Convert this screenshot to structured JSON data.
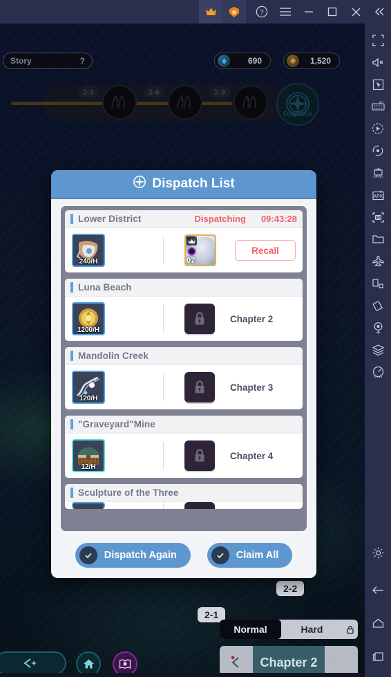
{
  "titlebar": {
    "buttons": [
      {
        "name": "premium-crown-button",
        "icon": "crown-icon",
        "label": "♛"
      },
      {
        "name": "shield-boost-button",
        "icon": "shield-icon",
        "label": "⬢"
      },
      {
        "name": "help-button",
        "icon": "help-circle-icon",
        "label": "?"
      },
      {
        "name": "menu-button",
        "icon": "hamburger-menu-icon",
        "label": "☰"
      },
      {
        "name": "minimize-button",
        "icon": "minimize-icon",
        "label": "—"
      },
      {
        "name": "maximize-button",
        "icon": "maximize-icon",
        "label": "□"
      },
      {
        "name": "close-button",
        "icon": "close-icon",
        "label": "✕"
      },
      {
        "name": "collapse-sidebar-button",
        "icon": "chevron-double-left-icon",
        "label": "«"
      }
    ]
  },
  "sidebar": {
    "items": [
      {
        "name": "fullscreen-icon",
        "label": "Fullscreen"
      },
      {
        "name": "mute-icon",
        "label": "Mute"
      },
      {
        "name": "cursor-icon",
        "label": "Pointer"
      },
      {
        "name": "keyboard-icon",
        "label": "Keyboard mapping"
      },
      {
        "name": "macro-record-icon",
        "label": "Macro"
      },
      {
        "name": "sync-icon",
        "label": "Sync"
      },
      {
        "name": "multi-instance-icon",
        "label": "Multi instance"
      },
      {
        "name": "apk-install-icon",
        "label": "Install APK"
      },
      {
        "name": "screenshot-icon",
        "label": "Screenshot"
      },
      {
        "name": "folder-icon",
        "label": "Media folder"
      },
      {
        "name": "airplane-icon",
        "label": "Eco mode"
      },
      {
        "name": "rotate-screen-icon",
        "label": "Rotate"
      },
      {
        "name": "shake-icon",
        "label": "Shake"
      },
      {
        "name": "location-icon",
        "label": "Location"
      },
      {
        "name": "layers-icon",
        "label": "Layers"
      },
      {
        "name": "performance-icon",
        "label": "Performance"
      }
    ],
    "bottom_items": [
      {
        "name": "settings-gear-icon",
        "label": "Settings"
      },
      {
        "name": "back-arrow-icon",
        "label": "Back"
      },
      {
        "name": "home-icon",
        "label": "Home"
      },
      {
        "name": "recent-apps-icon",
        "label": "Recent apps"
      }
    ]
  },
  "hud": {
    "story_label": "Story",
    "story_help": "?",
    "resources": [
      {
        "name": "gem-counter",
        "icon": "gem-icon",
        "value": "690"
      },
      {
        "name": "coin-counter",
        "icon": "coin-icon",
        "value": "1,520"
      }
    ],
    "path_nodes": [
      {
        "tag": "2-3"
      },
      {
        "tag": "2-6"
      },
      {
        "tag": "2-9"
      }
    ],
    "dispatch_node_label": "Dispatch",
    "map_tags": [
      "2-2",
      "2-1"
    ],
    "difficulty": {
      "options": [
        "Normal",
        "Hard"
      ],
      "selected": "Normal",
      "locked_option": "Hard"
    },
    "chapter_plate": "Chapter 2",
    "nav": [
      {
        "name": "nav-prev-button",
        "icon": "left-arrow-sparkle-icon"
      },
      {
        "name": "nav-home-button",
        "icon": "home-icon"
      },
      {
        "name": "nav-story-book-button",
        "icon": "book-icon"
      }
    ]
  },
  "modal": {
    "icon": "compass-icon",
    "title": "Dispatch List",
    "rows": [
      {
        "title": "Lower District",
        "status": "Dispatching",
        "time": "09:43:28",
        "item_rate": "240/H",
        "item_icon": "gauntlet-item-icon",
        "character": {
          "level": "07",
          "rank_icon": "crown-rank-icon",
          "element_icon": "element-orb-icon"
        },
        "action": "Recall",
        "state": "dispatching"
      },
      {
        "title": "Luna Beach",
        "item_rate": "1200/H",
        "item_icon": "gold-medal-item-icon",
        "requirement": "Chapter 2",
        "state": "locked"
      },
      {
        "title": "Mandolin Creek",
        "item_rate": "120/H",
        "item_icon": "river-item-icon",
        "requirement": "Chapter 3",
        "state": "locked"
      },
      {
        "title": "\"Graveyard\"Mine",
        "item_rate": "12/H",
        "item_icon": "chest-item-icon",
        "requirement": "Chapter 4",
        "state": "locked"
      },
      {
        "title": "Sculpture of the Three",
        "state": "partial"
      }
    ],
    "footer": {
      "dispatch_again": "Dispatch Again",
      "claim_all": "Claim All"
    }
  },
  "colors": {
    "accent_blue": "#5e97d0",
    "danger_red": "#f0606a",
    "panel_grey": "#7e8192",
    "titlebar": "#2b2f4e"
  }
}
